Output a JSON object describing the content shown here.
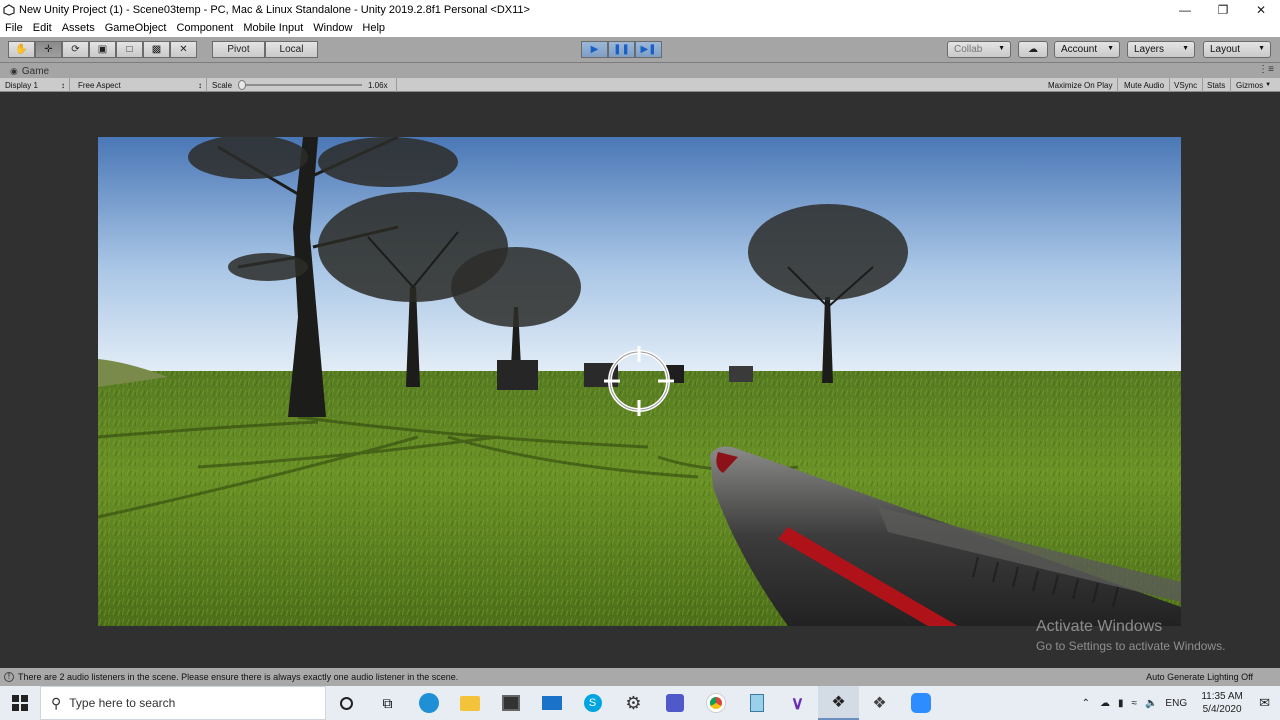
{
  "window": {
    "title": "New Unity Project (1) - Scene03temp - PC, Mac & Linux Standalone - Unity 2019.2.8f1 Personal <DX11>"
  },
  "menu": {
    "items": [
      "File",
      "Edit",
      "Assets",
      "GameObject",
      "Component",
      "Mobile Input",
      "Window",
      "Help"
    ]
  },
  "toolbar": {
    "pivot_label": "Pivot",
    "local_label": "Local",
    "collab_label": "Collab",
    "account_label": "Account",
    "layers_label": "Layers",
    "layout_label": "Layout"
  },
  "game_view": {
    "tab_label": "Game",
    "display_label": "Display 1",
    "aspect_label": "Free Aspect",
    "scale_label": "Scale",
    "scale_value": "1.06x",
    "maximize_label": "Maximize On Play",
    "mute_label": "Mute Audio",
    "vsync_label": "VSync",
    "stats_label": "Stats",
    "gizmos_label": "Gizmos"
  },
  "watermark": {
    "line1": "Activate Windows",
    "line2": "Go to Settings to activate Windows."
  },
  "status": {
    "message": "There are 2 audio listeners in the scene. Please ensure there is always exactly one audio listener in the scene.",
    "lighting": "Auto Generate Lighting Off"
  },
  "taskbar": {
    "search_placeholder": "Type here to search",
    "language": "ENG",
    "time": "11:35 AM",
    "date": "5/4/2020"
  },
  "colors": {
    "unity_toolbar": "#a5a5a5",
    "play_active": "#7e9ec4",
    "sky_top": "#4d79b8",
    "sky_horizon": "#dbe8f3",
    "grass": "#5f8a1e",
    "gun_red": "#b0121a"
  }
}
